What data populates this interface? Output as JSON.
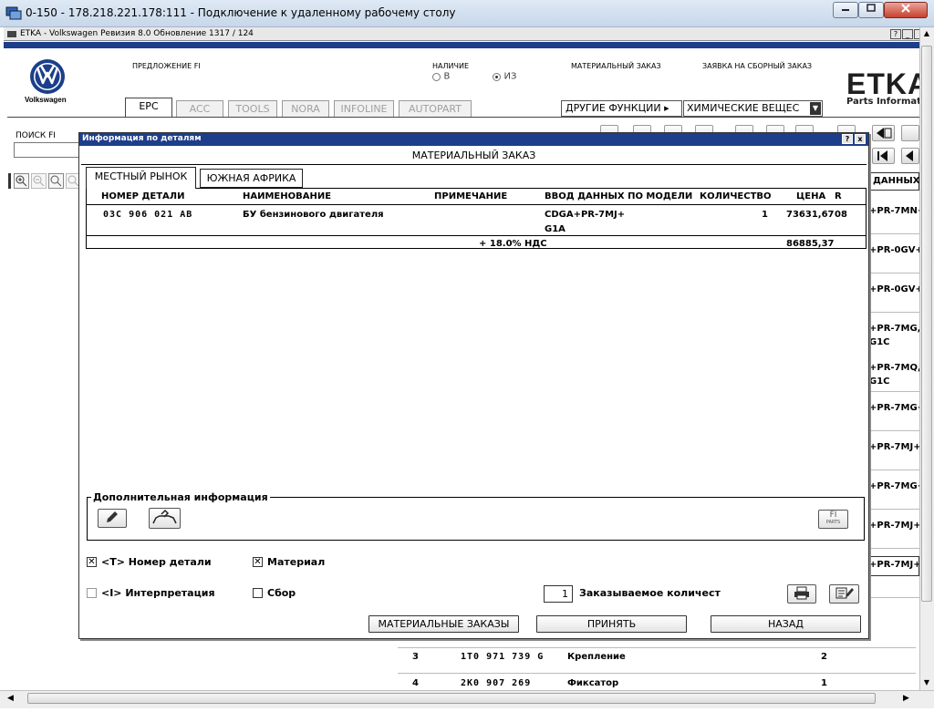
{
  "rdp": {
    "title": "0-150 - 178.218.221.178:111 - Подключение к удаленному рабочему столу"
  },
  "etka_window": {
    "title": "ETKA - Volkswagen Ревизия 8.0 Обновление 1317 / 124",
    "help": "?",
    "minimize": "_",
    "close": "x"
  },
  "header": {
    "brand": "Volkswagen",
    "offer_fi": "ПРЕДЛОЖЕНИЕ FI",
    "availability": {
      "label": "НАЛИЧИЕ",
      "option_in": "В",
      "option_from": "ИЗ",
      "selected": "ИЗ"
    },
    "material_order": "МАТЕРИАЛЬНЫЙ ЗАКАЗ",
    "assembly_order": "ЗАЯВКА НА СБОРНЫЙ ЗАКАЗ",
    "etka_logo": "ETKA",
    "etka_sub": "Parts Informati"
  },
  "tabs": [
    "EPC",
    "ACC",
    "TOOLS",
    "NORA",
    "INFOLINE",
    "AUTOPART"
  ],
  "other_functions": "ДРУГИЕ ФУНКЦИИ",
  "chemicals_select": "ХИМИЧЕСКИЕ ВЕЩЕС",
  "search": {
    "label": "ПОИСК FI",
    "value": ""
  },
  "background": {
    "col_header": "ДАННЫХ",
    "rows": [
      {
        "line1": "+PR-7MN+",
        "line2": ""
      },
      {
        "line1": "+PR-0GV+",
        "line2": ""
      },
      {
        "line1": "+PR-0GV+",
        "line2": ""
      },
      {
        "line1": "+PR-7MG,",
        "line2": "G1C"
      },
      {
        "line1": "+PR-7MQ,",
        "line2": "G1C"
      },
      {
        "line1": "+PR-7MG+",
        "line2": ""
      },
      {
        "line1": "+PR-7MJ+",
        "line2": ""
      },
      {
        "line1": "+PR-7MG+",
        "line2": ""
      },
      {
        "line1": "+PR-7MJ+",
        "line2": ""
      },
      {
        "line1": "+PR-7MJ+",
        "line2": ""
      }
    ],
    "bottom_rows": [
      {
        "pos": "3",
        "part": "1T0 971 739 G",
        "name": "Крепление",
        "qty": "2"
      },
      {
        "pos": "4",
        "part": "2K0 907 269",
        "name": "Фиксатор",
        "qty": "1"
      }
    ]
  },
  "dialog": {
    "title": "Информация по деталям",
    "help": "?",
    "close": "x",
    "heading": "МАТЕРИАЛЬНЫЙ ЗАКАЗ",
    "tabs": [
      "МЕСТНЫЙ РЫНОК",
      "ЮЖНАЯ АФРИКА"
    ],
    "columns": {
      "part_no": "НОМЕР ДЕТАЛИ",
      "name": "НАИМЕНОВАНИЕ",
      "note": "ПРИМЕЧАНИЕ",
      "model": "ВВОД ДАННЫХ ПО МОДЕЛИ",
      "qty": "КОЛИЧЕСТВО",
      "price": "ЦЕНА",
      "r": "R"
    },
    "row": {
      "part_no": "03C 906 021 AB",
      "name": "БУ бензинового двигателя",
      "note": "",
      "model_line1": "CDGA+PR-7MJ+",
      "model_line2": "G1A",
      "qty": "1",
      "price": "73631,67",
      "r": "08",
      "vat_label": "+ 18.0% НДС",
      "price_vat": "86885,37"
    },
    "extra_info_label": "Дополнительная информация",
    "fi_btn_top": "FI",
    "fi_btn_bottom": "PARTS",
    "checkboxes": {
      "part_number": {
        "label": "<T> Номер детали",
        "checked": true
      },
      "material": {
        "label": "Материал",
        "checked": true
      },
      "interpretation": {
        "label": "<I> Интерпретация",
        "checked": false
      },
      "assembly": {
        "label": "Сбор",
        "checked": false
      }
    },
    "order_qty": {
      "value": "1",
      "label": "Заказываемое количест"
    },
    "buttons": {
      "material_orders": "МАТЕРИАЛЬНЫЕ ЗАКАЗЫ",
      "accept": "ПРИНЯТЬ",
      "back": "НАЗАД"
    }
  }
}
